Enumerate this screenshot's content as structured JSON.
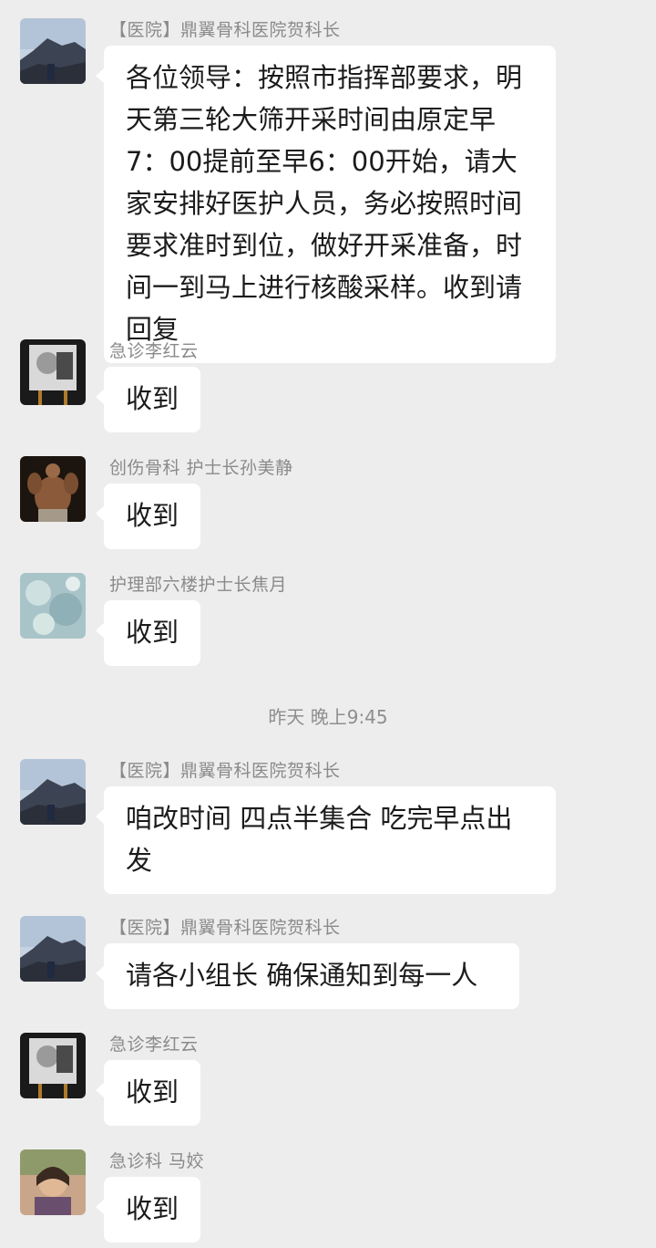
{
  "messages": [
    {
      "sender": "【医院】鼎翼骨科医院贺科长",
      "avatar": "mountain-avatar",
      "text": "各位领导：按照市指挥部要求，明天第三轮大筛开采时间由原定早7：00提前至早6：00开始，请大家安排好医护人员，务必按照时间要求准时到位，做好开采准备，时间一到马上进行核酸采样。收到请回复"
    },
    {
      "sender": "急诊李红云",
      "avatar": "portrait-avatar",
      "text": "收到"
    },
    {
      "sender": "创伤骨科  护士长孙美静",
      "avatar": "muscle-avatar",
      "text": "收到"
    },
    {
      "sender": "护理部六楼护士长焦月",
      "avatar": "crystal-avatar",
      "text": "收到"
    },
    {
      "sender": "【医院】鼎翼骨科医院贺科长",
      "avatar": "mountain-avatar",
      "text": "咱改时间 四点半集合 吃完早点出发"
    },
    {
      "sender": "【医院】鼎翼骨科医院贺科长",
      "avatar": "mountain-avatar",
      "text": "请各小组长 确保通知到每一人"
    },
    {
      "sender": "急诊李红云",
      "avatar": "portrait-avatar",
      "text": "收到"
    },
    {
      "sender": "急诊科 马姣",
      "avatar": "child-avatar",
      "text": "收到"
    }
  ],
  "timestamp": "昨天 晚上9:45",
  "colors": {
    "background": "#ededed",
    "bubble": "#ffffff",
    "sender_text": "#8a8a8a",
    "message_text": "#1b1b1b"
  }
}
